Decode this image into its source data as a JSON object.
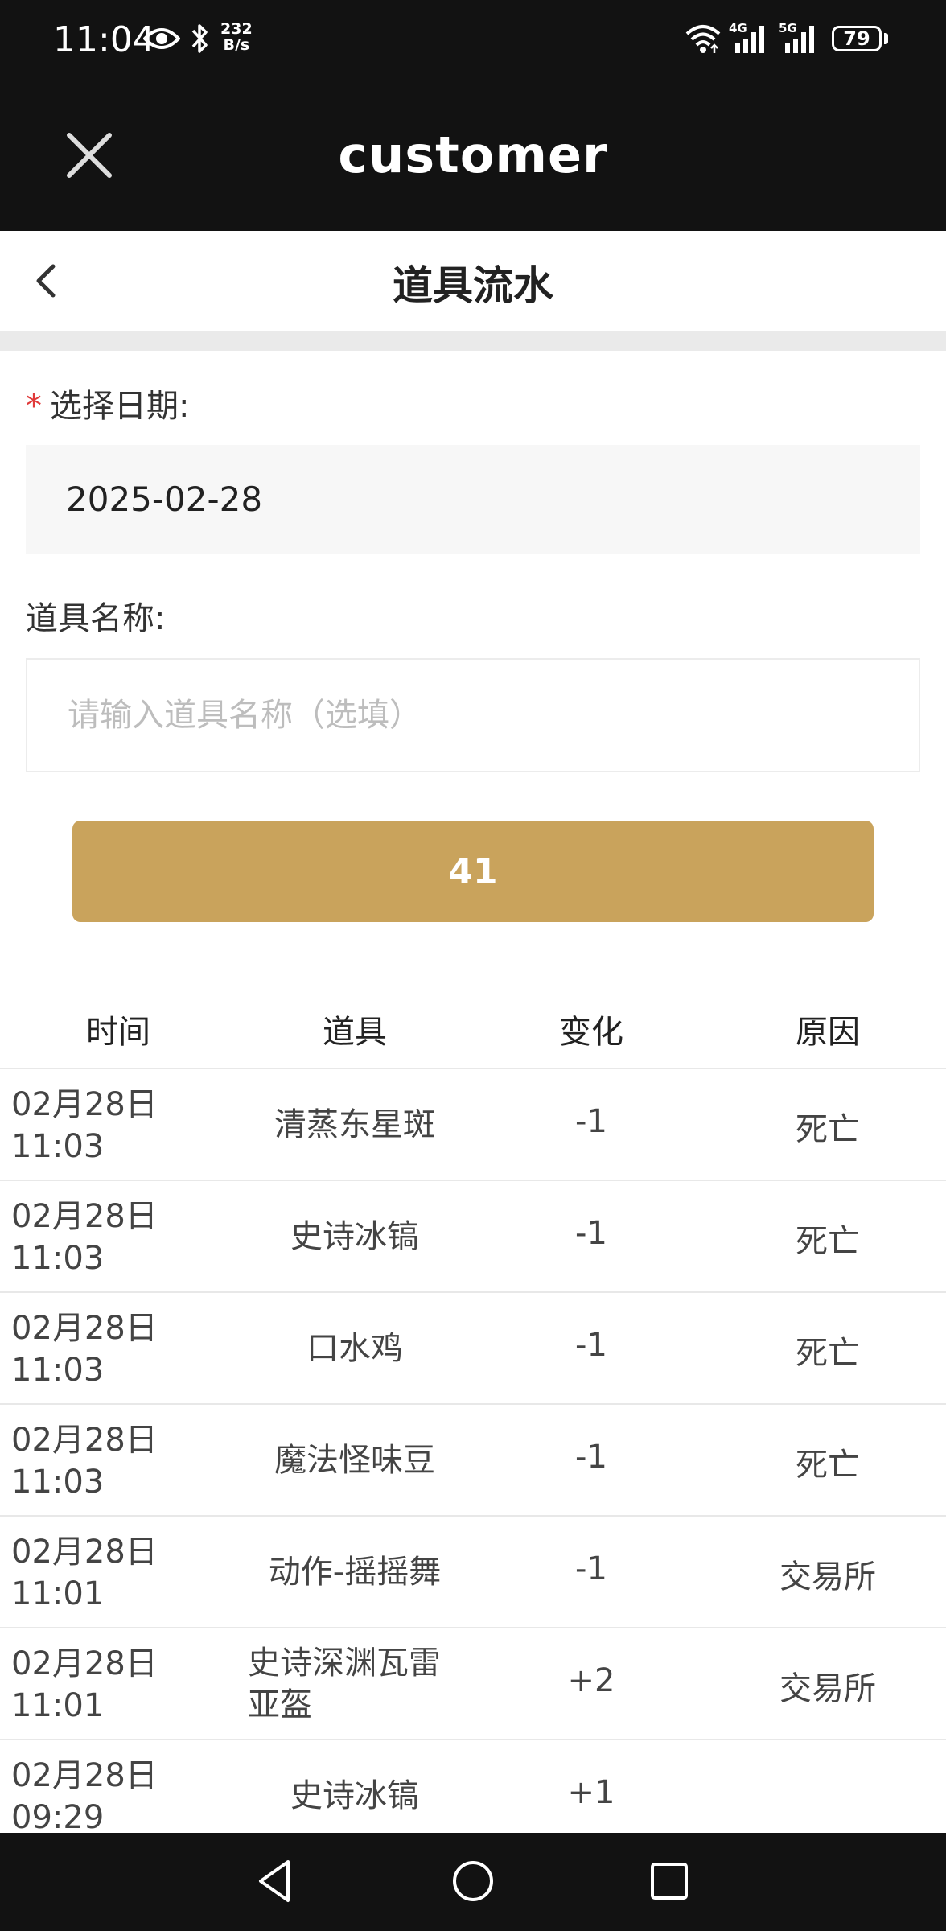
{
  "status": {
    "time": "11:04",
    "net_speed_top": "232",
    "net_speed_bottom": "B/s",
    "sig1_label": "4G",
    "sig2_label": "5G",
    "battery": "79"
  },
  "header": {
    "app_title": "customer"
  },
  "nav": {
    "page_title": "道具流水"
  },
  "form": {
    "date_label_required": "*",
    "date_label": "选择日期:",
    "date_value": "2025-02-28",
    "name_label": "道具名称:",
    "name_placeholder": "请输入道具名称（选填）",
    "submit_label": "41"
  },
  "table": {
    "headers": [
      "时间",
      "道具",
      "变化",
      "原因"
    ],
    "rows": [
      {
        "date": "02月28日",
        "time": "11:03",
        "item": "清蒸东星斑",
        "change": "-1",
        "reason": "死亡"
      },
      {
        "date": "02月28日",
        "time": "11:03",
        "item": "史诗冰镐",
        "change": "-1",
        "reason": "死亡"
      },
      {
        "date": "02月28日",
        "time": "11:03",
        "item": "口水鸡",
        "change": "-1",
        "reason": "死亡"
      },
      {
        "date": "02月28日",
        "time": "11:03",
        "item": "魔法怪味豆",
        "change": "-1",
        "reason": "死亡"
      },
      {
        "date": "02月28日",
        "time": "11:01",
        "item": "动作-摇摇舞",
        "change": "-1",
        "reason": "交易所"
      },
      {
        "date": "02月28日",
        "time": "11:01",
        "item_line1": "史诗深渊瓦雷",
        "item_line2": "亚盔",
        "change": "+2",
        "reason": "交易所"
      },
      {
        "date": "02月28日",
        "time": "09:29",
        "item": "史诗冰镐",
        "change": "+1",
        "reason": ""
      }
    ]
  }
}
